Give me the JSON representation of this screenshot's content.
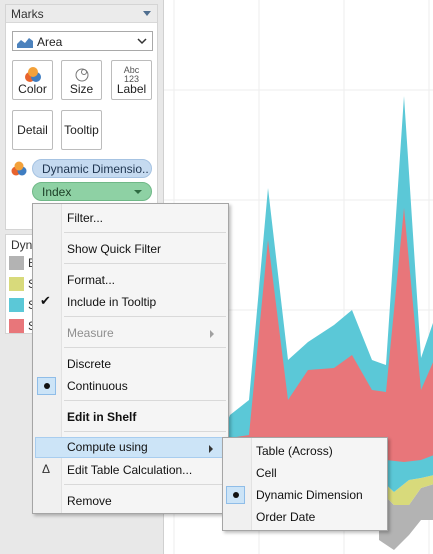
{
  "marks": {
    "title": "Marks",
    "mark_type": "Area",
    "buttons": {
      "color": "Color",
      "size": "Size",
      "label": "Label",
      "label_glyph": "Abc\n123",
      "detail": "Detail",
      "tooltip": "Tooltip"
    },
    "pills": {
      "dimension": "Dynamic Dimensio..",
      "index": "Index"
    }
  },
  "legend": {
    "title": "Dyna",
    "items": [
      {
        "label": "B",
        "color": "#b3b3b3"
      },
      {
        "label": "S",
        "color": "#d8da7b"
      },
      {
        "label": "S",
        "color": "#5bc8d7"
      },
      {
        "label": "S",
        "color": "#e8767a"
      }
    ]
  },
  "context_menu": {
    "items": [
      {
        "label": "Filter...",
        "state": "normal"
      },
      {
        "label": "Show Quick Filter",
        "state": "normal"
      },
      {
        "label": "Format...",
        "state": "normal"
      },
      {
        "label": "Include in Tooltip",
        "state": "checked"
      },
      {
        "label": "Measure",
        "state": "disabled",
        "submenu": true
      },
      {
        "label": "Discrete",
        "state": "normal"
      },
      {
        "label": "Continuous",
        "state": "selected-radio"
      },
      {
        "label": "Edit in Shelf",
        "state": "bold"
      },
      {
        "label": "Compute using",
        "state": "highlight",
        "submenu": true
      },
      {
        "label": "Edit Table Calculation...",
        "state": "delta"
      },
      {
        "label": "Remove",
        "state": "normal"
      }
    ]
  },
  "submenu": {
    "items": [
      {
        "label": "Table (Across)"
      },
      {
        "label": "Cell"
      },
      {
        "label": "Dynamic Dimension",
        "selected": true
      },
      {
        "label": "Order Date"
      }
    ]
  },
  "colors": {
    "series_red": "#e8767a",
    "series_cyan": "#5bc8d7",
    "series_yellow": "#d8da7b",
    "series_grey": "#b3b3b3",
    "menu_highlight": "#cce4f7",
    "pill_blue": "#c5daf0",
    "pill_green": "#8ed1a4"
  }
}
